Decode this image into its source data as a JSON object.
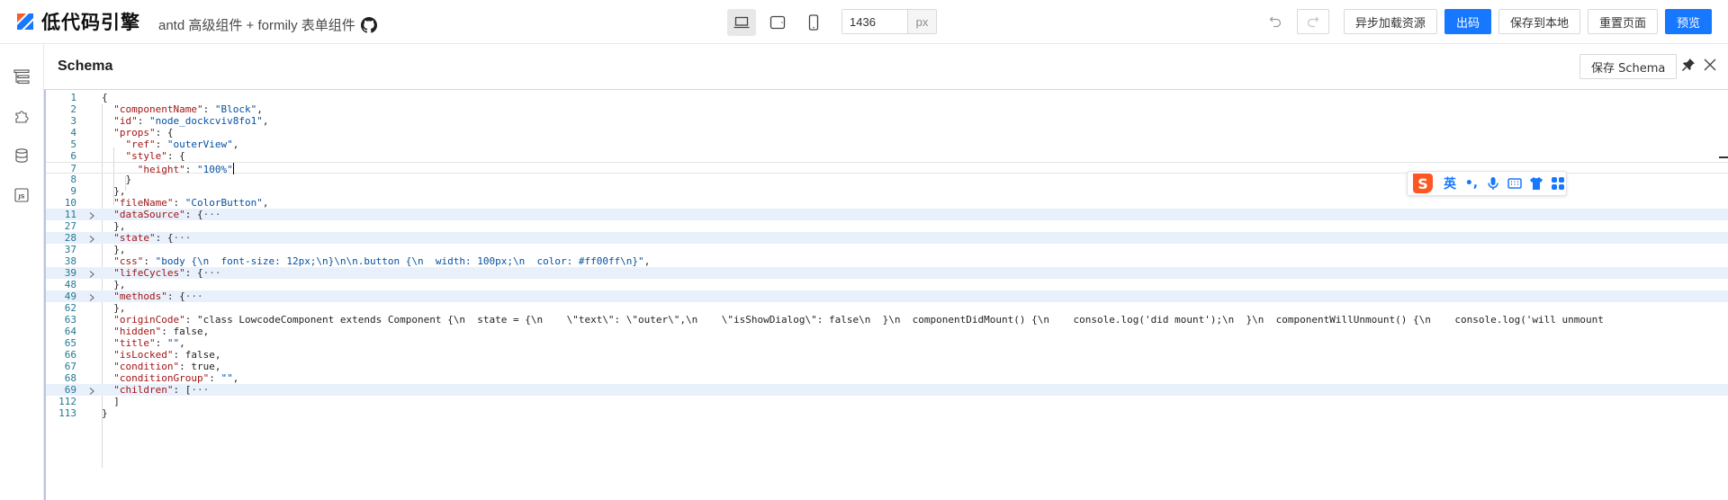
{
  "header": {
    "logo_text": "低代码引擎",
    "subtitle": "antd 高级组件 + formily 表单组件",
    "width_value": "1436",
    "width_unit": "px",
    "buttons": {
      "async_load": "异步加载资源",
      "export": "出码",
      "save_local": "保存到本地",
      "reset": "重置页面",
      "preview": "预览"
    }
  },
  "panel": {
    "title": "Schema",
    "save_label": "保存 Schema"
  },
  "code_lines": [
    {
      "ln": "1",
      "text": "{"
    },
    {
      "ln": "2",
      "text": "  \"componentName\": \"Block\","
    },
    {
      "ln": "3",
      "text": "  \"id\": \"node_dockcviv8fo1\","
    },
    {
      "ln": "4",
      "text": "  \"props\": {"
    },
    {
      "ln": "5",
      "text": "    \"ref\": \"outerView\","
    },
    {
      "ln": "6",
      "text": "    \"style\": {"
    },
    {
      "ln": "7",
      "text": "      \"height\": \"100%\""
    },
    {
      "ln": "8",
      "text": "    }"
    },
    {
      "ln": "9",
      "text": "  },"
    },
    {
      "ln": "10",
      "text": "  \"fileName\": \"ColorButton\","
    },
    {
      "ln": "11",
      "text": "  \"dataSource\": {···",
      "folded": true
    },
    {
      "ln": "27",
      "text": "  },"
    },
    {
      "ln": "28",
      "text": "  \"state\": {···",
      "folded": true
    },
    {
      "ln": "37",
      "text": "  },"
    },
    {
      "ln": "38",
      "text": "  \"css\": \"body {\\n  font-size: 12px;\\n}\\n\\n.button {\\n  width: 100px;\\n  color: #ff00ff\\n}\","
    },
    {
      "ln": "39",
      "text": "  \"lifeCycles\": {···",
      "folded": true
    },
    {
      "ln": "48",
      "text": "  },"
    },
    {
      "ln": "49",
      "text": "  \"methods\": {···",
      "folded": true
    },
    {
      "ln": "62",
      "text": "  },"
    },
    {
      "ln": "63",
      "text": "  \"originCode\": \"class LowcodeComponent extends Component {\\n  state = {\\n    \\\"text\\\": \\\"outer\\\",\\n    \\\"isShowDialog\\\": false\\n  }\\n  componentDidMount() {\\n    console.log('did mount');\\n  }\\n  componentWillUnmount() {\\n    console.log('will unmount"
    },
    {
      "ln": "64",
      "text": "  \"hidden\": false,"
    },
    {
      "ln": "65",
      "text": "  \"title\": \"\","
    },
    {
      "ln": "66",
      "text": "  \"isLocked\": false,"
    },
    {
      "ln": "67",
      "text": "  \"condition\": true,"
    },
    {
      "ln": "68",
      "text": "  \"conditionGroup\": \"\","
    },
    {
      "ln": "69",
      "text": "  \"children\": [···",
      "folded": true
    },
    {
      "ln": "112",
      "text": "  ]"
    },
    {
      "ln": "113",
      "text": "}"
    }
  ],
  "ime": {
    "lang": "英",
    "punct": "•,"
  },
  "colors": {
    "primary": "#1677ff",
    "json_key": "#a31515",
    "json_string": "#0451a5",
    "line_number": "#237893",
    "fold_highlight": "#e8f1fb"
  },
  "icons": {
    "sidebar": [
      "outline-tree-icon",
      "component-library-icon",
      "datasource-icon",
      "js-code-icon"
    ],
    "devices": [
      "desktop-icon",
      "tablet-icon",
      "mobile-icon"
    ]
  }
}
